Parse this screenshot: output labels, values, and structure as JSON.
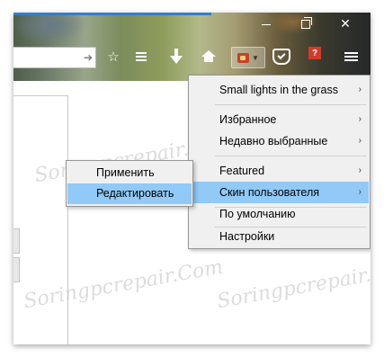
{
  "watermark": "Soringpcrepair.Com",
  "toolbar": {
    "addon_badge": "?"
  },
  "menu": {
    "items": [
      {
        "label": "Small lights in the grass",
        "has_submenu": true
      },
      {
        "label": "Избранное",
        "has_submenu": true
      },
      {
        "label": "Недавно выбранные",
        "has_submenu": true
      },
      {
        "label": "Featured",
        "has_submenu": true
      },
      {
        "label": "Скин пользователя",
        "has_submenu": true,
        "highlighted": true
      },
      {
        "label": "По умолчанию",
        "has_submenu": false
      },
      {
        "label": "Настройки",
        "has_submenu": false
      }
    ],
    "arrow": "›"
  },
  "submenu": {
    "items": [
      {
        "label": "Применить"
      },
      {
        "label": "Редактировать",
        "highlighted": true
      }
    ]
  },
  "colors": {
    "highlight": "#91c9f7",
    "menu_bg": "#f0f0f0",
    "addon_badge": "#d23a2a"
  }
}
